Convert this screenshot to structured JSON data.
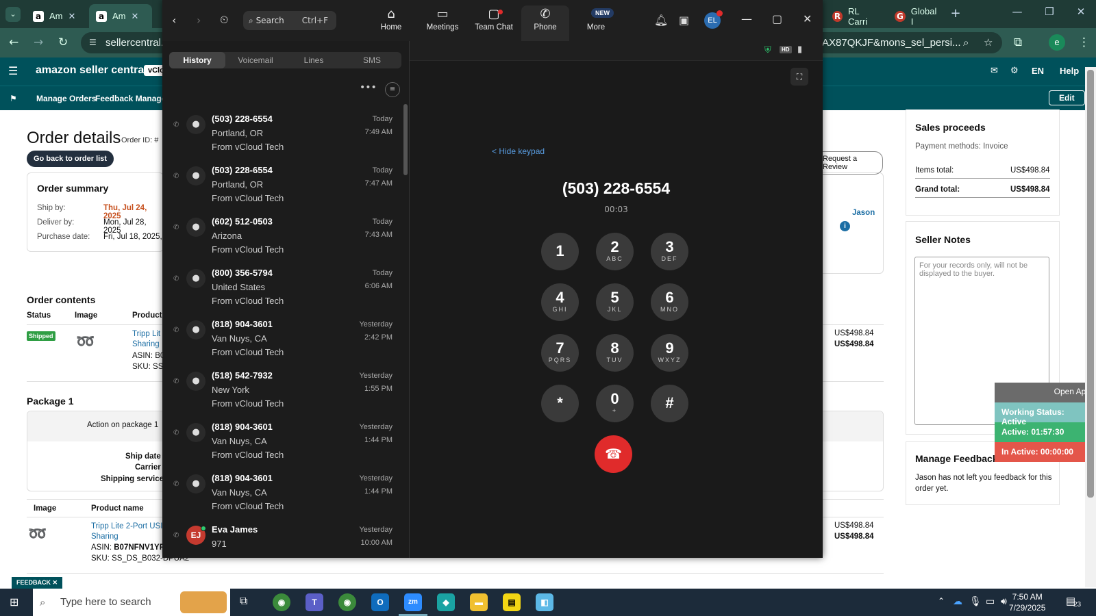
{
  "browser": {
    "tabs": [
      {
        "label": "Am"
      },
      {
        "label": "Am"
      },
      {
        "label": "RL Carri"
      },
      {
        "label": "Global I"
      }
    ],
    "url_left": "sellercentral.a",
    "url_right": "AX87QKJF&mons_sel_persi...",
    "profile_initial": "e"
  },
  "amazon": {
    "logo": "amazon seller central",
    "account_tag": "vClo",
    "header_right": {
      "lang": "EN",
      "help": "Help"
    },
    "nav": {
      "manage_orders": "Manage Orders",
      "feedback_manager": "Feedback Manager",
      "edit": "Edit"
    },
    "title": "Order details",
    "order_id_label": "Order ID: #",
    "back_button": "Go back to order list",
    "request_review": "Request a Review",
    "buyer_name": "Jason",
    "summary": {
      "heading": "Order summary",
      "ship_by_label": "Ship by:",
      "ship_by_value": "Thu, Jul 24, 2025",
      "deliver_by_label": "Deliver by:",
      "deliver_by_value": "Mon, Jul 28, 2025",
      "purchase_label": "Purchase date:",
      "purchase_value": "Fri, Jul 18, 2025,"
    },
    "contents": {
      "heading": "Order contents",
      "col_status": "Status",
      "col_image": "Image",
      "col_product": "Product",
      "status": "Shipped",
      "product_line1": "Tripp Lit",
      "product_line2": "Sharing",
      "asin": "ASIN: B0",
      "sku": "SKU: SS_",
      "price1": "US$498.84",
      "price2": "US$498.84"
    },
    "package": {
      "heading": "Package 1",
      "action": "Action on package 1",
      "ship_date": "Ship date",
      "carrier": "Carrier",
      "service": "Shipping service"
    },
    "items": {
      "col_image": "Image",
      "col_name": "Product name",
      "name_line1": "Tripp Lite 2-Port USI",
      "name_line2": "Sharing",
      "asin_label": "ASIN:",
      "asin_value": "B07NFNV1YF",
      "sku": "SKU: SS_DS_B032-DPUA2",
      "price1": "US$498.84",
      "price2": "US$498.84"
    },
    "sales": {
      "heading": "Sales proceeds",
      "payment": "Payment methods: Invoice",
      "items_total_label": "Items total:",
      "items_total": "US$498.84",
      "grand_total_label": "Grand total:",
      "grand_total": "US$498.84"
    },
    "notes": {
      "heading": "Seller Notes",
      "placeholder": "For your records only, will not be displayed to the buyer."
    },
    "feedback": {
      "heading": "Manage Feedback",
      "text": "Jason has not left you feedback for this order yet."
    },
    "feedback_tab": "FEEDBACK"
  },
  "work_widget": {
    "open_app": "Open App",
    "status": "Working Status: Active",
    "active": "Active: 01:57:30",
    "inactive": "In Active: 00:00:00",
    "colors": {
      "status": "#7fc4c0",
      "active": "#3cb371",
      "inactive": "#e4564a"
    }
  },
  "zoom": {
    "search_placeholder": "Search",
    "search_shortcut": "Ctrl+F",
    "nav": [
      {
        "label": "Home",
        "icon": "home-icon"
      },
      {
        "label": "Meetings",
        "icon": "video-icon"
      },
      {
        "label": "Team Chat",
        "icon": "chat-icon"
      },
      {
        "label": "Phone",
        "icon": "phone-icon"
      },
      {
        "label": "More",
        "icon": "more-icon"
      }
    ],
    "new_badge": "NEW",
    "avatar": "EL",
    "tabs": [
      "History",
      "Voicemail",
      "Lines",
      "SMS"
    ],
    "calls": [
      {
        "number": "(503) 228-6554",
        "location": "Portland, OR",
        "source": "From vCloud Tech",
        "day": "Today",
        "time": "7:49 AM"
      },
      {
        "number": "(503) 228-6554",
        "location": "Portland, OR",
        "source": "From vCloud Tech",
        "day": "Today",
        "time": "7:47 AM"
      },
      {
        "number": "(602) 512-0503",
        "location": "Arizona",
        "source": "From vCloud Tech",
        "day": "Today",
        "time": "7:43 AM"
      },
      {
        "number": "(800) 356-5794",
        "location": "United States",
        "source": "From vCloud Tech",
        "day": "Today",
        "time": "6:06 AM"
      },
      {
        "number": "(818) 904-3601",
        "location": "Van Nuys, CA",
        "source": "From vCloud Tech",
        "day": "Yesterday",
        "time": "2:42 PM"
      },
      {
        "number": "(518) 542-7932",
        "location": "New York",
        "source": "From vCloud Tech",
        "day": "Yesterday",
        "time": "1:55 PM"
      },
      {
        "number": "(818) 904-3601",
        "location": "Van Nuys, CA",
        "source": "From vCloud Tech",
        "day": "Yesterday",
        "time": "1:44 PM"
      },
      {
        "number": "(818) 904-3601",
        "location": "Van Nuys, CA",
        "source": "From vCloud Tech",
        "day": "Yesterday",
        "time": "1:44 PM"
      },
      {
        "number": "Eva James",
        "location": "971",
        "source": "",
        "day": "Yesterday",
        "time": "10:00 AM",
        "initials": "EJ"
      }
    ],
    "hide_keypad": "< Hide keypad",
    "active_number": "(503) 228-6554",
    "call_timer": "00:03",
    "keypad": [
      {
        "d": "1",
        "l": ""
      },
      {
        "d": "2",
        "l": "ABC"
      },
      {
        "d": "3",
        "l": "DEF"
      },
      {
        "d": "4",
        "l": "GHI"
      },
      {
        "d": "5",
        "l": "JKL"
      },
      {
        "d": "6",
        "l": "MNO"
      },
      {
        "d": "7",
        "l": "PQRS"
      },
      {
        "d": "8",
        "l": "TUV"
      },
      {
        "d": "9",
        "l": "WXYZ"
      },
      {
        "d": "*",
        "l": ""
      },
      {
        "d": "0",
        "l": "+"
      },
      {
        "d": "#",
        "l": ""
      }
    ]
  },
  "taskbar": {
    "search_placeholder": "Type here to search",
    "time": "7:50 AM",
    "date": "7/29/2025",
    "notifications": "23"
  }
}
